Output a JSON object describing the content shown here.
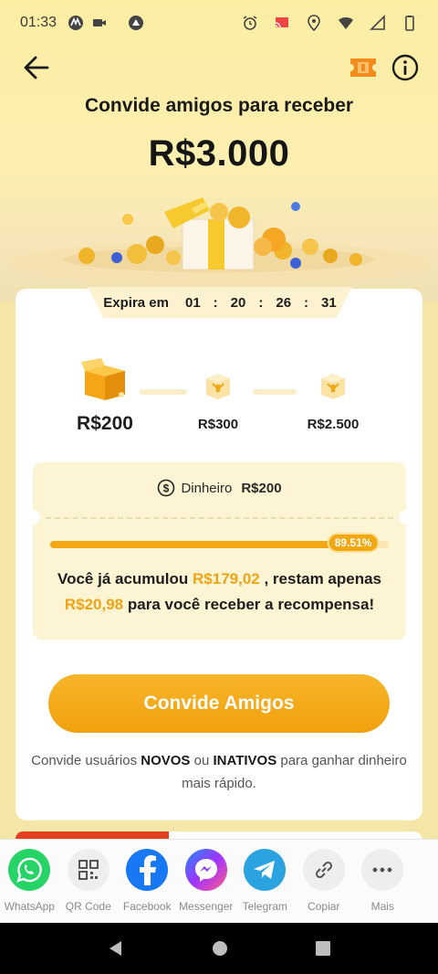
{
  "status_bar": {
    "time": "01:33",
    "icons": [
      "motorola-icon",
      "video-icon",
      "app-icon",
      "alarm-icon",
      "cast-icon",
      "location-icon",
      "wifi-icon",
      "signal-icon",
      "battery-icon"
    ]
  },
  "header": {
    "back_icon": "arrow-left-icon",
    "ticket_icon": "ticket-icon",
    "info_icon": "info-icon",
    "title": "Convide amigos para receber",
    "amount": "R$3.000"
  },
  "timer": {
    "label": "Expira em",
    "hours": "01",
    "minutes": "20",
    "seconds": "26",
    "fraction": "31",
    "separator": ":"
  },
  "steps": [
    {
      "label": "R$200",
      "state": "current"
    },
    {
      "label": "R$300",
      "state": "locked"
    },
    {
      "label": "R$2.500",
      "state": "locked"
    }
  ],
  "reward": {
    "icon": "dollar-coin-icon",
    "type_label": "Dinheiro",
    "value": "R$200",
    "progress_percent": 89.51,
    "progress_label": "89.51%",
    "msg_part1": "Você já acumulou",
    "accumulated": "R$179,02",
    "msg_part2": ", restam apenas",
    "remaining": "R$20,98",
    "msg_part3": "para você receber a recompensa!"
  },
  "cta": {
    "button_label": "Convide Amigos",
    "note_part1": "Convide usuários",
    "note_bold1": "NOVOS",
    "note_part2": "ou",
    "note_bold2": "INATIVOS",
    "note_part3": "para ganhar dinheiro mais rápido."
  },
  "share": [
    {
      "label": "WhatsApp",
      "icon": "whatsapp-icon",
      "color": "#25d366"
    },
    {
      "label": "QR Code",
      "icon": "qr-code-icon",
      "color": "#eeeeee"
    },
    {
      "label": "Facebook",
      "icon": "facebook-icon",
      "color": "#1877f2"
    },
    {
      "label": "Messenger",
      "icon": "messenger-icon",
      "color": "#a033ff"
    },
    {
      "label": "Telegram",
      "icon": "telegram-icon",
      "color": "#2aa3e0"
    },
    {
      "label": "Copiar",
      "icon": "link-icon",
      "color": "#eeeeee"
    },
    {
      "label": "Mais",
      "icon": "more-icon",
      "color": "#eeeeee"
    }
  ],
  "nav": {
    "back": "nav-back-icon",
    "home": "nav-home-icon",
    "recents": "nav-recents-icon"
  },
  "colors": {
    "accent": "#f3a713",
    "background": "#f4e6a6",
    "highlight_text": "#f1a316"
  }
}
